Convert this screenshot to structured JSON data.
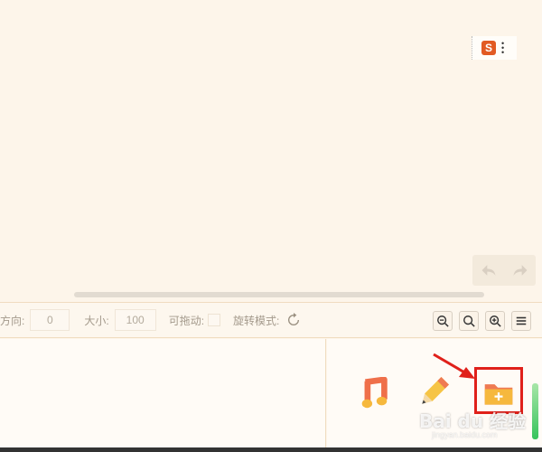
{
  "ime": {
    "logo_text": "S"
  },
  "history": {
    "undo_icon": "undo-arrow-icon",
    "redo_icon": "redo-arrow-icon"
  },
  "toolbar": {
    "direction_label": "方向:",
    "direction_value": "0",
    "size_label": "大小:",
    "size_value": "100",
    "draggable_label": "可拖动:",
    "rotate_mode_label": "旋转模式:",
    "rotate_icon": "rotate-icon",
    "zoom_buttons": [
      "zoom-out-icon",
      "zoom-reset-icon",
      "zoom-in-icon",
      "menu-icon"
    ]
  },
  "tools": {
    "music_icon": "music-note-icon",
    "pencil_icon": "pencil-icon",
    "add_folder_icon": "folder-add-icon"
  },
  "watermark": {
    "text": "Bai du 经验",
    "sub": "jingyan.baidu.com"
  },
  "colors": {
    "background": "#fdf5ea",
    "highlight": "#e0201a",
    "folder": "#f6b83d",
    "scroll": "#36c35c"
  }
}
